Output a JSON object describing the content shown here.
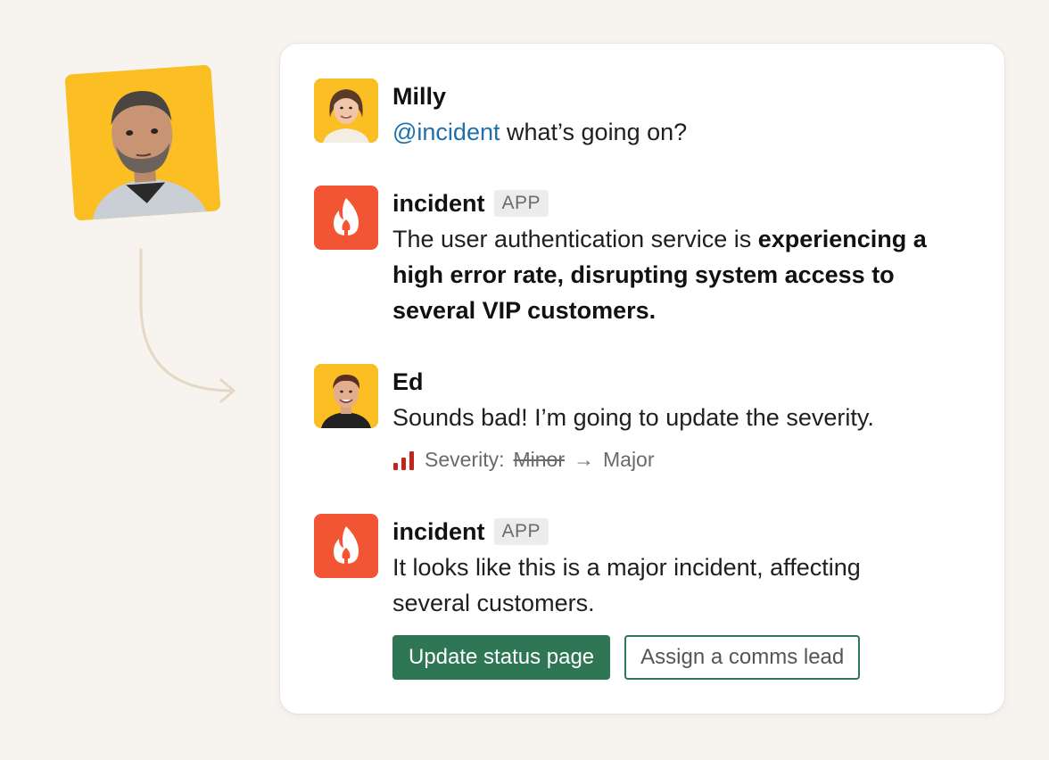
{
  "messages": [
    {
      "name": "Milly",
      "mention": "@incident",
      "text": " what’s going on?"
    },
    {
      "name": "incident",
      "badge": "APP",
      "parts": [
        "The user authentication service is ",
        "experiencing a high error rate, disrupting system access to several VIP customers."
      ]
    },
    {
      "name": "Ed",
      "text": "Sounds bad! I’m going to update the severity.",
      "severity": {
        "label": "Severity:",
        "old": "Minor",
        "arrow": "→",
        "new": "Major"
      }
    },
    {
      "name": "incident",
      "badge": "APP",
      "text": "It looks like this is a major incident, affecting several customers.",
      "buttons": {
        "primary": "Update status page",
        "secondary": "Assign a comms lead"
      }
    }
  ],
  "colors": {
    "accent": "#2f7654",
    "mention": "#1f6fa8",
    "incident_brand": "#f25533",
    "avatar_bg": "#fbbf24",
    "severity_icon": "#c0261e"
  },
  "icons": {
    "incident_logo": "flame-icon",
    "severity": "signal-bars-icon",
    "connector": "curved-arrow-icon"
  }
}
